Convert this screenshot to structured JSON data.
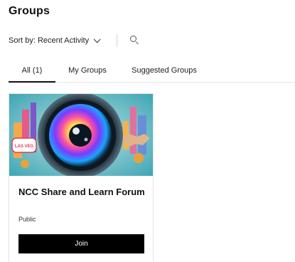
{
  "header": {
    "title": "Groups"
  },
  "toolbar": {
    "sort_label": "Sort by: Recent Activity",
    "sort_icon": "chevron-down-icon",
    "search_icon": "search-icon"
  },
  "tabs": [
    {
      "label": "All (1)",
      "selected": true
    },
    {
      "label": "My Groups",
      "selected": false
    },
    {
      "label": "Suggested Groups",
      "selected": false
    }
  ],
  "groups": [
    {
      "name": "NCC Share and Learn Forum",
      "privacy": "Public",
      "join_label": "Join",
      "image_sign_text": "LAS VEG"
    }
  ],
  "colors": {
    "accent": "#000000",
    "button_text": "#ffffff",
    "image_bg": "#5fb8c4"
  }
}
